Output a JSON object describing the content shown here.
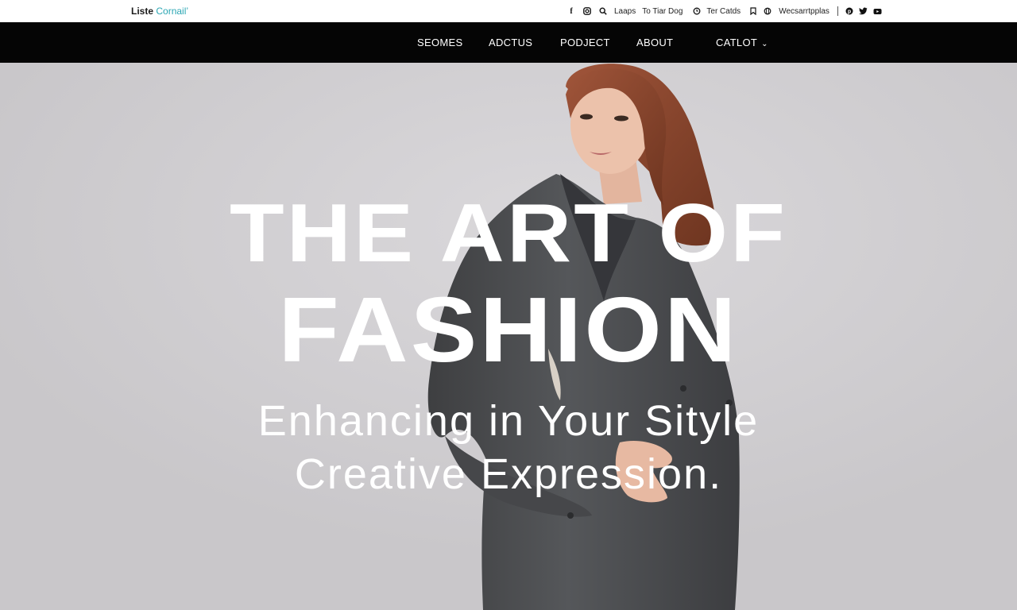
{
  "logo": {
    "part1": "Liste",
    "part2": "Cornail’"
  },
  "utility_bar": {
    "icons_left": [
      "facebook-icon",
      "instagram-icon",
      "search-icon"
    ],
    "link1": "Laaps",
    "link2": "To Tiar Dog",
    "link3": "Ter Catds",
    "link4": "Wecsarrtpplas",
    "icons_right": [
      "pinterest-icon",
      "twitter-icon",
      "youtube-icon"
    ]
  },
  "nav": {
    "items": [
      {
        "label": "SEOMES"
      },
      {
        "label": "ADCTUS"
      },
      {
        "label": "PODJECT"
      },
      {
        "label": "ABOUT"
      },
      {
        "label": "CATLOT",
        "has_dropdown": true
      }
    ]
  },
  "hero": {
    "headline_line1": "THE ART OF",
    "headline_line2": "FASHION",
    "tagline_line1": "Enhancing in Your Sityle",
    "tagline_line2": "Creative Expression."
  },
  "colors": {
    "nav_background": "#050505",
    "topbar_background": "#ffffff",
    "logo_accent": "#2aa6b3",
    "hero_background": "#cfcdd0",
    "headline_text": "#ffffff",
    "coat": "#4a4b4d",
    "hair": "#8a4a2c"
  }
}
